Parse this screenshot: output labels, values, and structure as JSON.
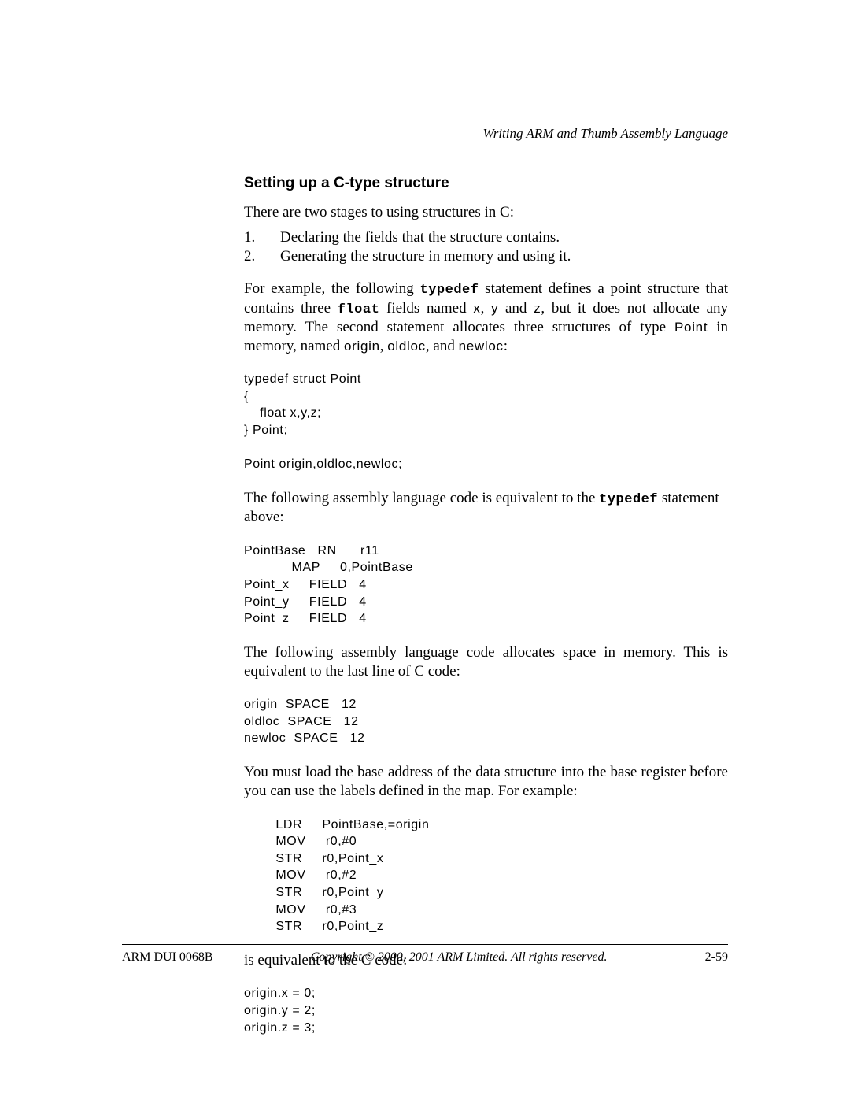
{
  "running_head": "Writing ARM and Thumb Assembly Language",
  "section_title": "Setting up a C-type structure",
  "intro": "There are two stages to using structures in C:",
  "list": {
    "item1": "Declaring the fields that the structure contains.",
    "item2": "Generating the structure in memory and using it."
  },
  "para1": {
    "seg1": "For example, the following ",
    "kw1": "typedef",
    "seg2": " statement defines a point structure that contains three ",
    "kw2": "float",
    "seg3": " fields named ",
    "tt1": "x",
    "seg4": ", ",
    "tt2": "y",
    "seg5": " and ",
    "tt3": "z",
    "seg6": ", but it does not allocate any memory. The second statement allocates three structures of type ",
    "tt4": "Point",
    "seg7": " in memory, named ",
    "tt5": "origin",
    "seg8": ", ",
    "tt6": "oldloc",
    "seg9": ", and ",
    "tt7": "newloc",
    "seg10": ":"
  },
  "code1": "typedef struct Point\n{\n    float x,y,z;\n} Point;\n\nPoint origin,oldloc,newloc;",
  "para2": {
    "seg1": "The following assembly language code is equivalent to the ",
    "kw1": "typedef",
    "seg2": " statement above:"
  },
  "code2": "PointBase   RN      r11\n            MAP     0,PointBase\nPoint_x     FIELD   4\nPoint_y     FIELD   4\nPoint_z     FIELD   4",
  "para3": "The following assembly language code allocates space in memory. This is equivalent to the last line of C code:",
  "code3": "origin  SPACE   12\noldloc  SPACE   12\nnewloc  SPACE   12",
  "para4": "You must load the base address of the data structure into the base register before you can use the labels defined in the map. For example:",
  "code4": "        LDR     PointBase,=origin\n        MOV     r0,#0\n        STR     r0,Point_x\n        MOV     r0,#2\n        STR     r0,Point_y\n        MOV     r0,#3\n        STR     r0,Point_z",
  "para5": "is equivalent to the C code:",
  "code5": "origin.x = 0;\norigin.y = 2;\norigin.z = 3;",
  "footer": {
    "left": "ARM DUI 0068B",
    "mid": "Copyright © 2000, 2001 ARM Limited. All rights reserved.",
    "right": "2-59"
  }
}
